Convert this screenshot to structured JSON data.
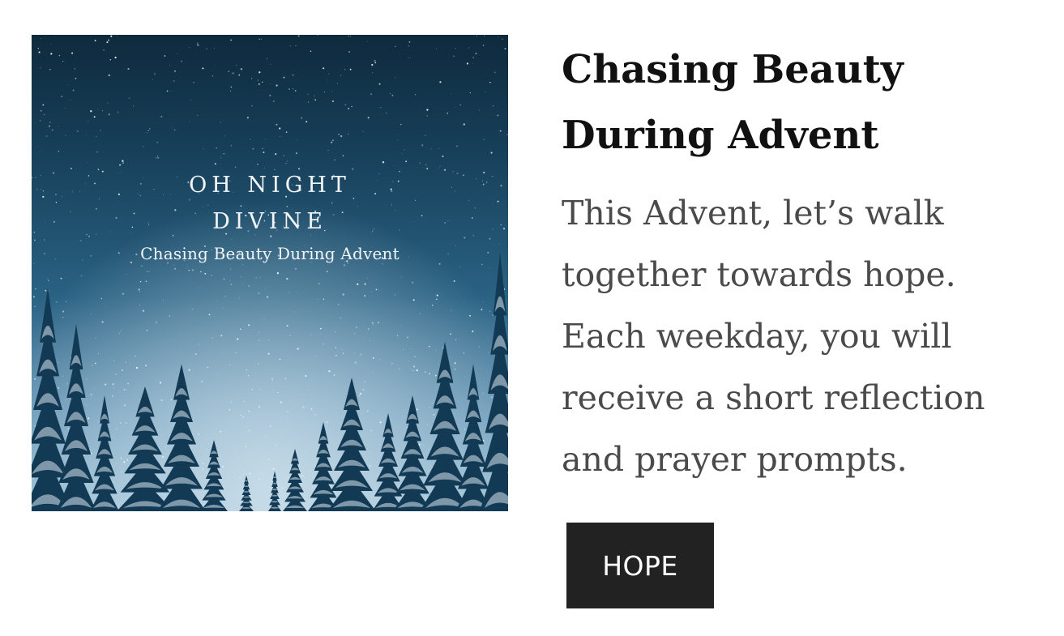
{
  "cover": {
    "title_line1": "OH NIGHT",
    "title_line2": "DIVINE",
    "subtitle": "Chasing Beauty During Advent",
    "colors": {
      "sky_top": "#0f2a3d",
      "sky_bottom": "#9ec1d6",
      "trees": "#123a54",
      "snow": "#d9e6ee"
    }
  },
  "content": {
    "title": "Chasing Beauty During Advent",
    "description": "This Advent, let’s walk together towards hope. Each weekday, you will receive a short reflection and prayer prompts.",
    "button_label": "HOPE"
  },
  "colors": {
    "title": "#111111",
    "body_text": "#4a4a4a",
    "button_bg": "#222222",
    "button_text": "#ffffff"
  }
}
